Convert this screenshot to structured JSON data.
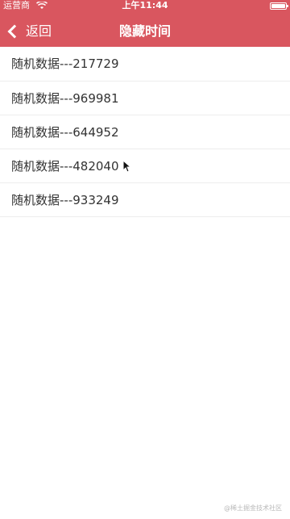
{
  "status_bar": {
    "carrier": "运营商",
    "time": "上午11:44",
    "wifi_icon": "wifi-icon",
    "battery_icon": "battery-icon"
  },
  "nav": {
    "back_label": "返回",
    "back_icon": "chevron-left-icon",
    "title": "隐藏时间"
  },
  "list": {
    "items": [
      {
        "label": "随机数据---217729"
      },
      {
        "label": "随机数据---969981"
      },
      {
        "label": "随机数据---644952"
      },
      {
        "label": "随机数据---482040"
      },
      {
        "label": "随机数据---933249"
      }
    ]
  },
  "watermark": "@稀土掘金技术社区",
  "colors": {
    "header": "#d9565f",
    "text": "#333333",
    "divider": "#ededed"
  }
}
